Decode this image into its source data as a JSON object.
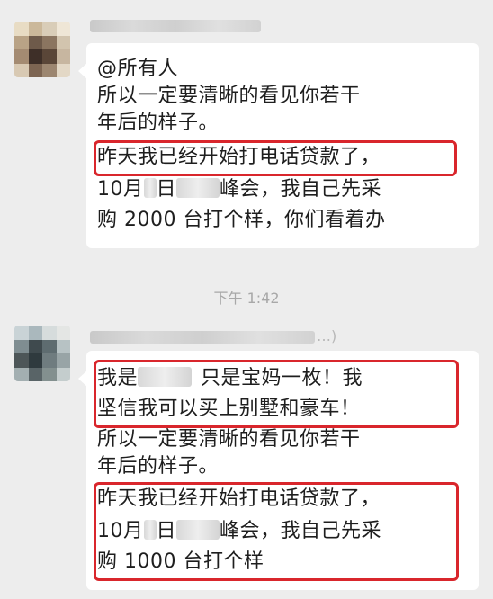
{
  "timestamp": "下午 1:42",
  "messages": [
    {
      "lines": [
        "@所有人",
        "所以一定要清晰的看见你若干",
        "年后的样子。",
        "昨天我已经开始打电话贷款了，",
        "10月",
        "日",
        "峰会，我自己先采",
        "购 2000 台打个样，你们看着办"
      ]
    },
    {
      "sender_tail": "…)",
      "lines": [
        "我是",
        "只是宝妈一枚！我",
        "坚信我可以买上别墅和豪车！",
        "所以一定要清晰的看见你若干",
        "年后的样子。",
        "昨天我已经开始打电话贷款了，",
        "10月",
        "日",
        "峰会，我自己先采",
        "购 1000 台打个样"
      ]
    }
  ],
  "colors": {
    "background": "#ededed",
    "bubble": "#ffffff",
    "highlight_border": "#d9262c",
    "timestamp": "#a8a8a8"
  },
  "icons": [
    "avatar-pixelated"
  ]
}
